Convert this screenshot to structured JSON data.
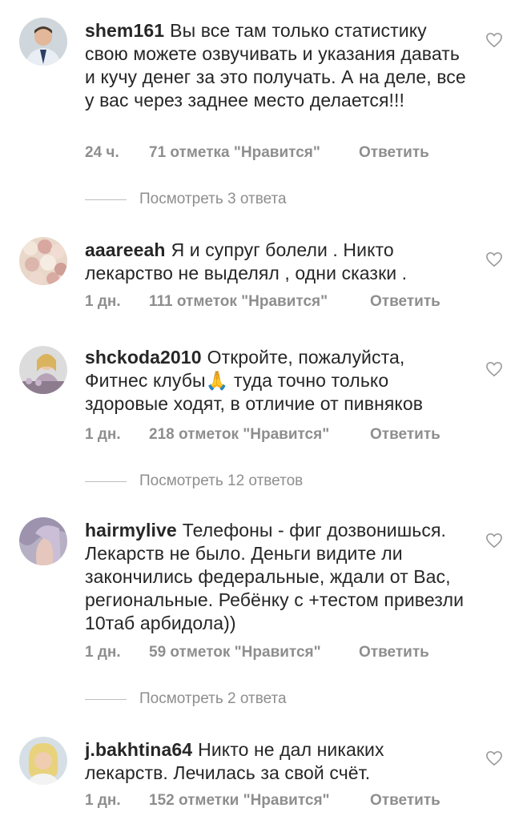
{
  "comments": [
    {
      "username": "shem161",
      "text": "Вы все там только статистику свою можете озвучивать и указания давать и кучу денег за это получать. А на деле, все у вас через заднее место делается!!!",
      "time": "24 ч.",
      "likes": "71 отметка \"Нравится\"",
      "reply": "Ответить",
      "view_replies": "Посмотреть 3 ответа"
    },
    {
      "username": "aaareeah",
      "text": "Я и супруг болели . Никто лекарство не выделял , одни сказки .",
      "time": "1 дн.",
      "likes": "111 отметок \"Нравится\"",
      "reply": "Ответить"
    },
    {
      "username": "shckoda2010",
      "text": "Откройте, пожалуйста, Фитнес клубы🙏 туда точно только здоровые ходят, в отличие от пивняков",
      "time": "1 дн.",
      "likes": "218 отметок \"Нравится\"",
      "reply": "Ответить",
      "view_replies": "Посмотреть 12 ответов"
    },
    {
      "username": "hairmylive",
      "text": "Телефоны - фиг дозвонишься. Лекарств не было. Деньги видите ли закончились федеральные, ждали от Вас, региональные. Ребёнку с +тестом привезли 10таб арбидола))",
      "time": "1 дн.",
      "likes": "59 отметок \"Нравится\"",
      "reply": "Ответить",
      "view_replies": "Посмотреть 2 ответа"
    },
    {
      "username": "j.bakhtina64",
      "text": "Никто не дал никаких лекарств. Лечилась за свой счёт.",
      "time": "1 дн.",
      "likes": "152 отметки \"Нравится\"",
      "reply": "Ответить"
    }
  ],
  "colors": {
    "text": "#262626",
    "meta": "#8e8e8e"
  },
  "icons": {
    "like": "heart-outline-icon"
  }
}
